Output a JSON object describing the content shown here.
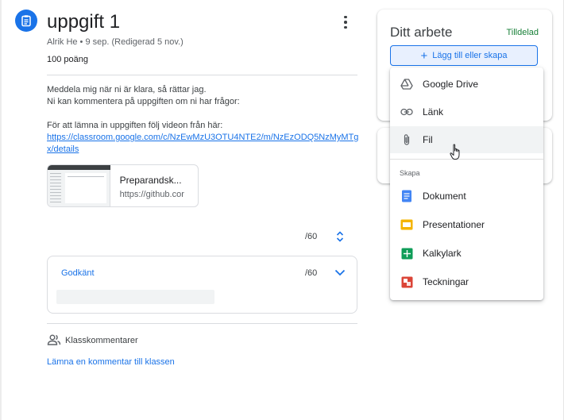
{
  "assignment": {
    "title": "uppgift 1",
    "meta": "Alrik He • 9 sep. (Redigerad 5 nov.)",
    "points": "100 poäng",
    "description_lines": [
      "Meddela mig när ni är klara, så rättar jag.",
      "Ni kan kommentera på uppgiften om ni har frågor:",
      "",
      "För att lämna in uppgiften följ videon från här:"
    ],
    "link": "https://classroom.google.com/c/NzEwMzU3OTU4NTE2/m/NzEzODQ5NzMyMTgx/details"
  },
  "attachment": {
    "title": "Preparandsk...",
    "url": "https://github.cor"
  },
  "grading": {
    "score_label": "/60",
    "card": {
      "label": "Godkänt",
      "score": "/60"
    }
  },
  "class_comments": {
    "title": "Klasskommentarer",
    "add_link": "Lämna en kommentar till klassen"
  },
  "your_work": {
    "title": "Ditt arbete",
    "status": "Tilldelad",
    "status_color": "#188038",
    "add_button": "Lägg till eller skapa"
  },
  "add_menu": {
    "items": [
      {
        "label": "Google Drive",
        "icon": "google-drive-icon"
      },
      {
        "label": "Länk",
        "icon": "link-icon"
      },
      {
        "label": "Fil",
        "icon": "paperclip-icon",
        "hovered": true
      }
    ],
    "create_section": "Skapa",
    "create_items": [
      {
        "label": "Dokument",
        "icon": "docs-icon",
        "color": "#4285f4"
      },
      {
        "label": "Presentationer",
        "icon": "slides-icon",
        "color": "#f4b400"
      },
      {
        "label": "Kalkylark",
        "icon": "sheets-icon",
        "color": "#0f9d58"
      },
      {
        "label": "Teckningar",
        "icon": "drawings-icon",
        "color": "#db4437"
      }
    ]
  },
  "colors": {
    "accent": "#1a73e8"
  }
}
